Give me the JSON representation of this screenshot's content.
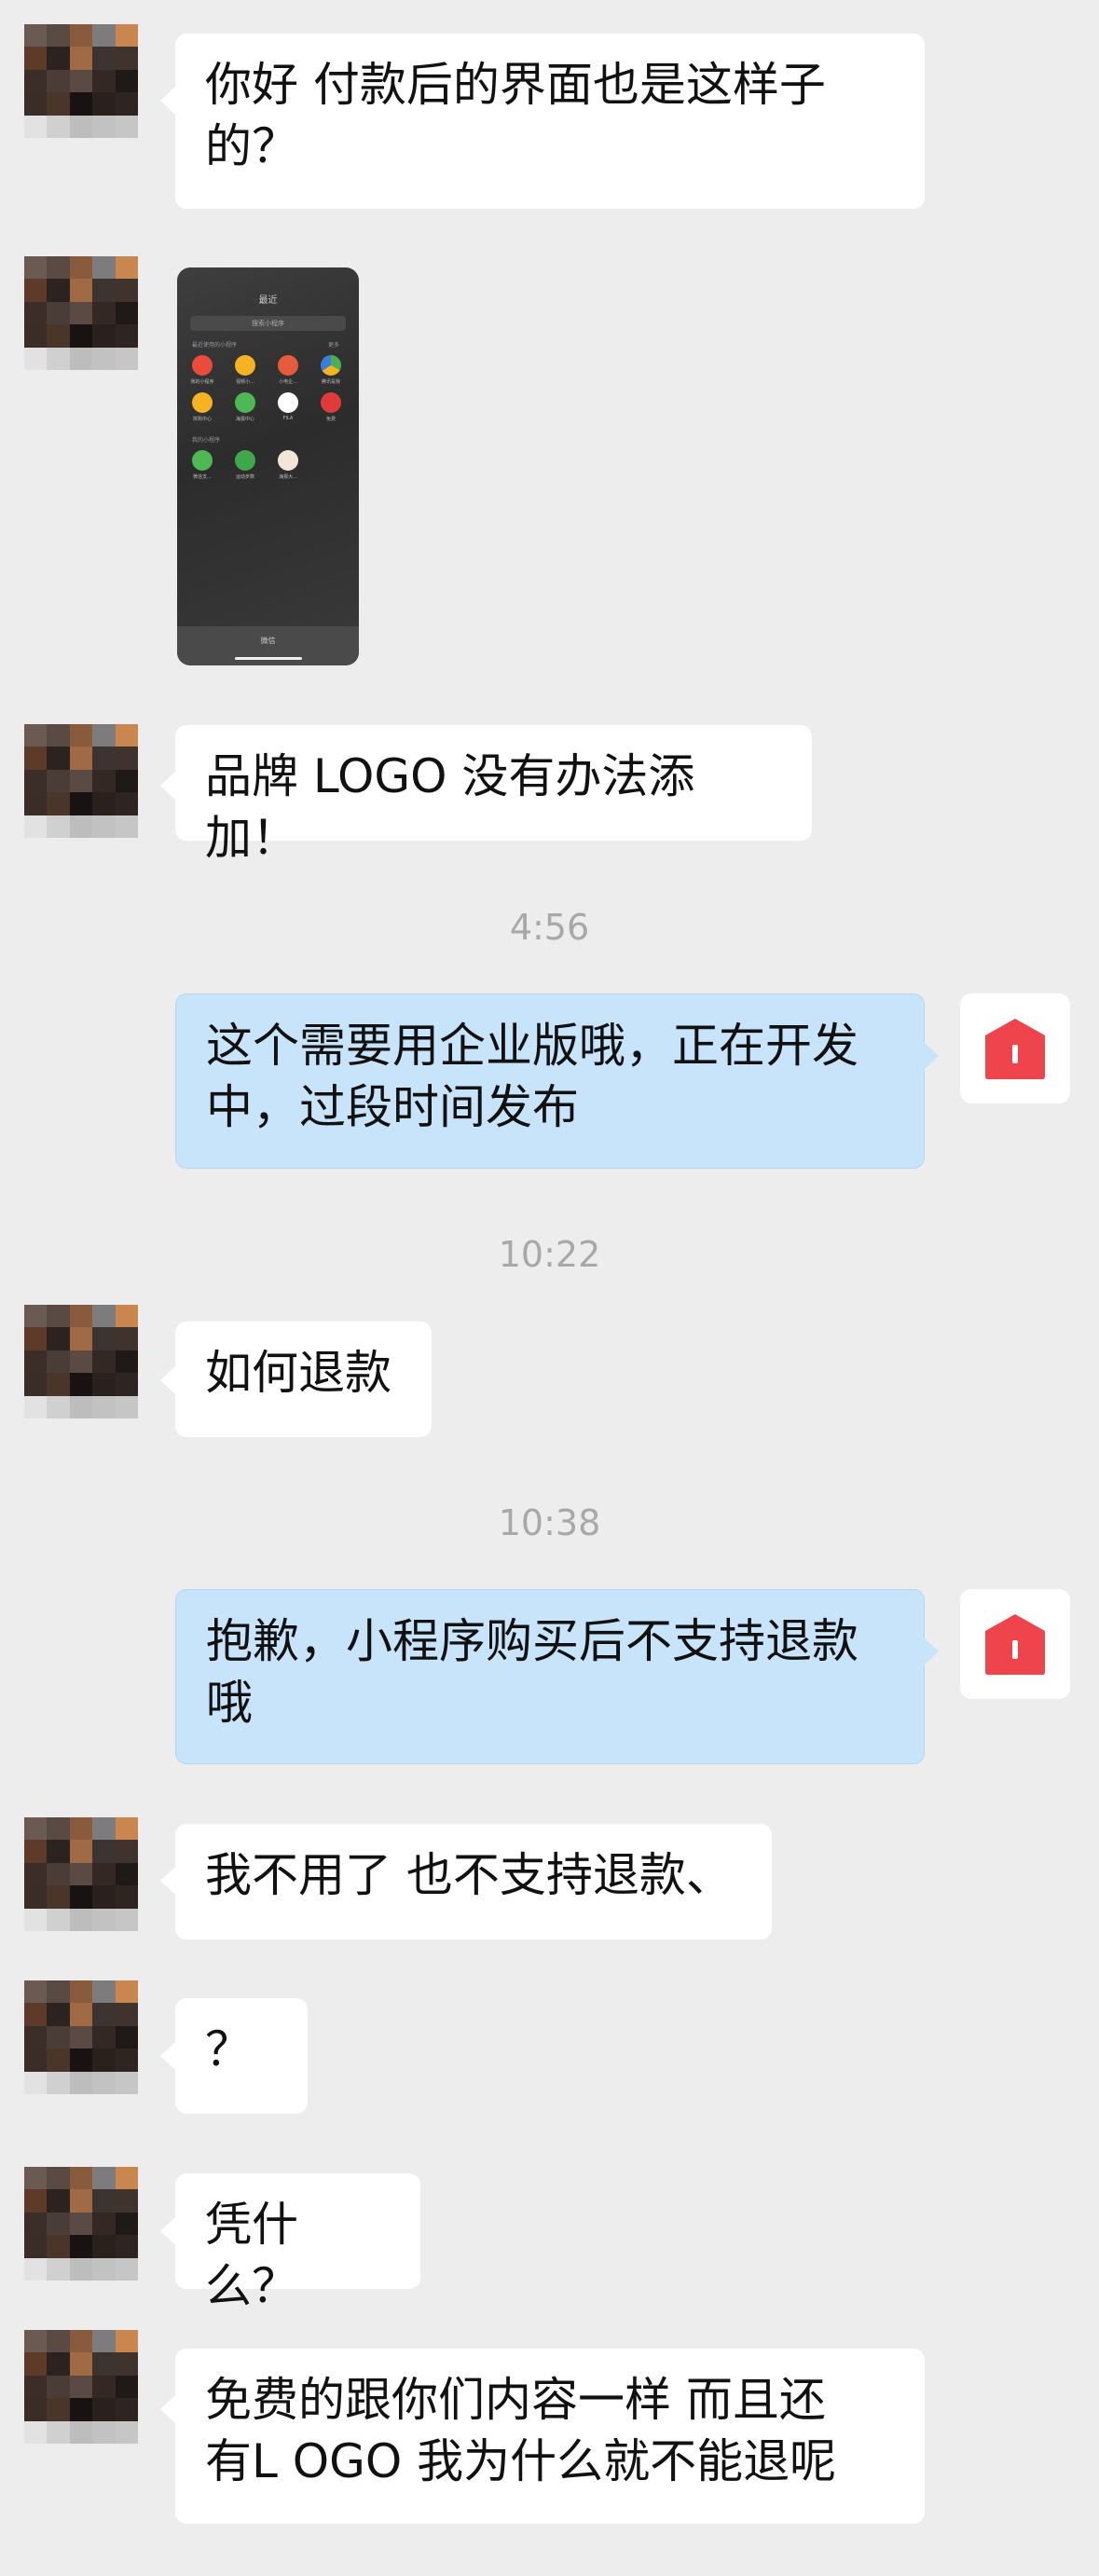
{
  "messages": [
    {
      "side": "in",
      "lines": [
        "你好 付款后的界面也是这样子",
        "的？"
      ]
    },
    {
      "side": "in",
      "type": "image",
      "thumbnail": {
        "title": "最近",
        "search_placeholder": "搜索小程序",
        "section1": "最近使用的小程序",
        "more": "更多",
        "apps_row1": [
          "我的小程序",
          "视频小...",
          "小电企...",
          "腾讯是我"
        ],
        "apps_row2": [
          "拼购中心",
          "海报中心",
          "FILA",
          "免费"
        ],
        "section2": "我的小程序",
        "apps_row3": [
          "微信支...",
          "运动步数",
          "海报大..."
        ],
        "bottom_label": "微信"
      }
    },
    {
      "side": "in",
      "lines": [
        "品牌 LOGO 没有办法添加！"
      ]
    },
    {
      "timestamp": "4:56"
    },
    {
      "side": "out",
      "lines": [
        "这个需要用企业版哦，正在开发",
        "中，过段时间发布"
      ]
    },
    {
      "timestamp": "10:22"
    },
    {
      "side": "in",
      "lines": [
        "如何退款"
      ]
    },
    {
      "timestamp": "10:38"
    },
    {
      "side": "out",
      "lines": [
        "抱歉，小程序购买后不支持退款",
        "哦"
      ]
    },
    {
      "side": "in",
      "lines": [
        "我不用了 也不支持退款、"
      ]
    },
    {
      "side": "in",
      "lines": [
        "？"
      ]
    },
    {
      "side": "in",
      "lines": [
        "凭什么？"
      ]
    },
    {
      "side": "in",
      "lines": [
        "免费的跟你们内容一样 而且还",
        "有L OGO 我为什么就不能退呢"
      ]
    }
  ],
  "colors": {
    "background": "#EDEDED",
    "incoming_bubble": "#FFFFFF",
    "outgoing_bubble": "#C8E4FA",
    "timestamp": "#A8A8A8",
    "bot_icon": "#F0444D"
  }
}
